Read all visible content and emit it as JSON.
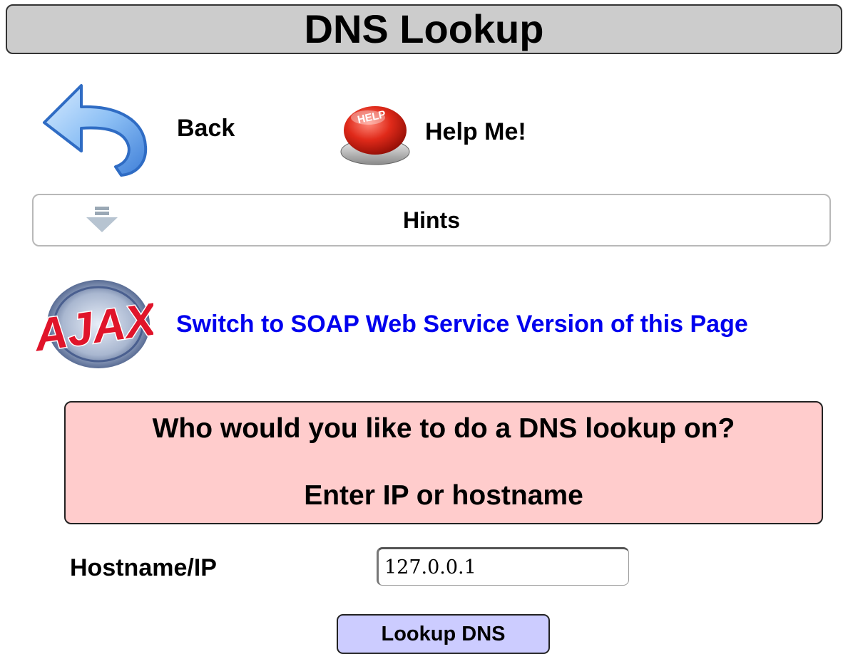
{
  "header": {
    "title": "DNS Lookup"
  },
  "nav": {
    "back_label": "Back",
    "help_label": "Help Me!",
    "help_icon_text": "HELP"
  },
  "hints": {
    "label": "Hints"
  },
  "service_switch": {
    "label": "Switch to SOAP Web Service Version of this Page",
    "logo_text": "AJAX"
  },
  "prompt": {
    "line1": "Who would you like to do a DNS lookup on?",
    "line2": "Enter IP or hostname"
  },
  "form": {
    "hostname_label": "Hostname/IP",
    "hostname_value": "127.0.0.1",
    "submit_label": "Lookup DNS"
  },
  "colors": {
    "title_bg": "#cccccc",
    "link": "#0000ee",
    "prompt_bg": "#ffcccc",
    "button_bg": "#ccccff"
  }
}
